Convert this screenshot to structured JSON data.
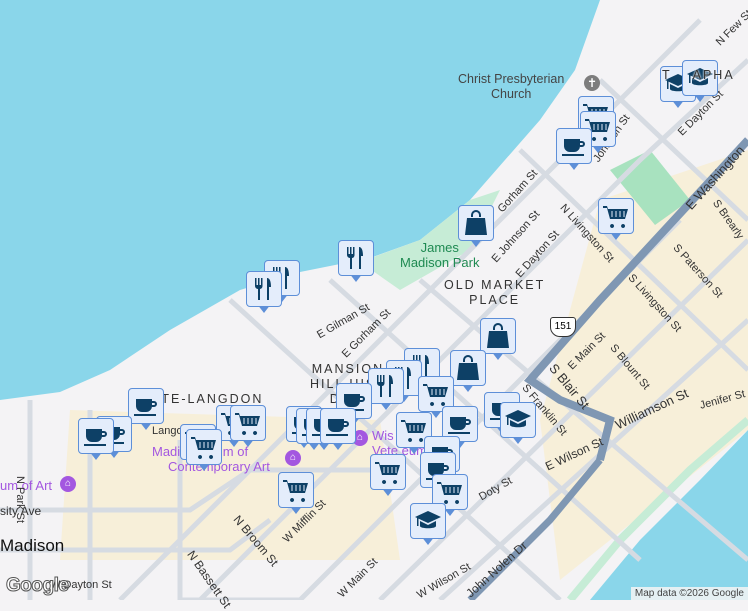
{
  "map": {
    "colors": {
      "water": "#8ad6ea",
      "land": "#f4f3f5",
      "park": "#c6ecd6",
      "road": "#d6dbe2",
      "highway": "#7f97b3",
      "urban": "#f7efd9",
      "marker_fill": "#e4edfb",
      "marker_border": "#5d8fd8",
      "icon": "#0d4066"
    },
    "area_labels": [
      "MANSION HILL HISTORIC DISTRICT",
      "MANSION",
      "HILL HI",
      "DIST",
      "OLD MARKET",
      "PLACE",
      "MATE-LANGDON",
      "TENNEY-LAPHAM"
    ],
    "visible_area": {
      "mansion1": "MANSION",
      "mansion2": "HILL HIST",
      "mansion3": "DIST",
      "omp1": "OLD MARKET",
      "omp2": "PLACE",
      "langdon": "ATE-LANGDON",
      "lapham": "T    APHA"
    },
    "parks": {
      "james1": "James",
      "james2": "Madison Park"
    },
    "pois": {
      "church1": "Christ Presbyterian",
      "church2": "Church",
      "mmoca1": "Madi    Museum of",
      "mmoca2": "Contemporary Art",
      "chazen": "um of Art",
      "wis1": "Wis",
      "wis2": "Vete      eum"
    },
    "city": "Madison",
    "streets": {
      "gorham1": "E Gorham St",
      "gorham2": "Gorham St",
      "johnson": "E Johnson St",
      "johnson2": "Johnson St",
      "dayton": "E Dayton St",
      "dayton2": "E Dayton St",
      "livingston": "N Livingston St",
      "slivingston": "S Livingston St",
      "paterson": "S Paterson St",
      "brearly": "S Brearly",
      "washington": "E Washington",
      "blair": "S Blair St",
      "emain": "E Main St",
      "blount": "S Blount St",
      "williamson": "Williamson St",
      "jenifer": "Jenifer St",
      "wilson": "E Wilson St",
      "franklin": "S Franklin St",
      "gilman": "E Gilman St",
      "broom": "N Broom St",
      "bassett": "N Bassett St",
      "mifflin": "W Mifflin St",
      "wmain": "W Main St",
      "wwilson": "W Wilson St",
      "doty": "Doty St",
      "nolen": "John Nolen Dr",
      "park": "N Park St",
      "univ": "sity Ave",
      "dayton3": "W Dayton St",
      "few": "N Few St",
      "langdon": "Lango",
      "shiv": "N P"
    },
    "route_shield": "151",
    "icons": [
      "coffee-icon",
      "shopping-cart-icon",
      "restaurant-icon",
      "shopping-bag-icon",
      "school-icon"
    ],
    "google_logo": "Google",
    "attribution": "Map data ©2026 Google"
  }
}
